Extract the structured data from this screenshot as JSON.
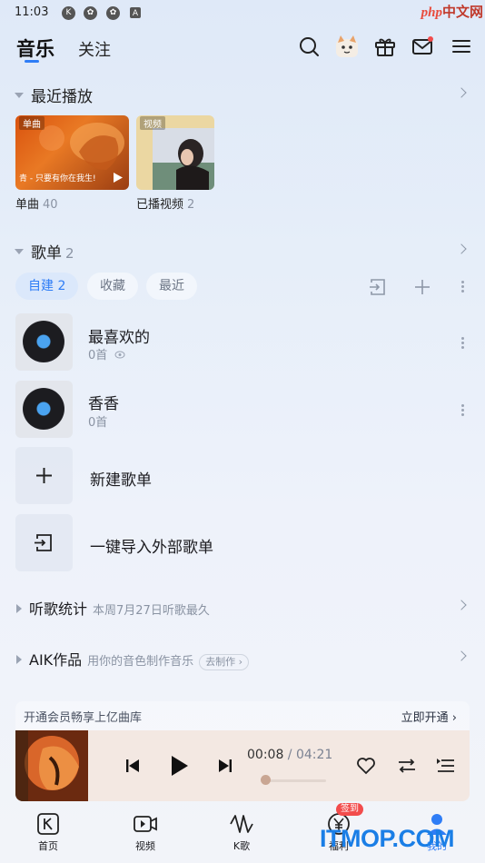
{
  "status_bar": {
    "time": "11:03",
    "icons": [
      "k-icon",
      "butterfly-icon",
      "butterfly-icon",
      "a-icon"
    ]
  },
  "watermark": {
    "php": "php",
    "cn": "中文网"
  },
  "header": {
    "tab_music": "音乐",
    "tab_follow": "关注"
  },
  "recent": {
    "title": "最近播放",
    "items": [
      {
        "tag": "单曲",
        "caption": "青 - 只要有你在我生!",
        "label": "单曲",
        "count": "40"
      },
      {
        "tag": "视频",
        "label": "已播视频",
        "count": "2"
      }
    ]
  },
  "playlists": {
    "title": "歌单",
    "count": "2",
    "chips": [
      "自建 2",
      "收藏",
      "最近"
    ],
    "items": [
      {
        "title": "最喜欢的",
        "sub": "0首"
      },
      {
        "title": "香香",
        "sub": "0首"
      }
    ],
    "actions": [
      "新建歌单",
      "一键导入外部歌单"
    ]
  },
  "stats": {
    "title": "听歌统计",
    "sub": "本周7月27日听歌最久"
  },
  "aik": {
    "title": "AIK作品",
    "sub": "用你的音色制作音乐",
    "pill": "去制作"
  },
  "vip": {
    "left": "开通会员畅享上亿曲库",
    "right": "立即开通"
  },
  "player": {
    "current": "00:08",
    "separator": " / ",
    "total": "04:21",
    "progress": 0.03
  },
  "nav": {
    "items": [
      "首页",
      "视频",
      "K歌",
      "福利",
      "我的"
    ],
    "badge": "签到"
  },
  "brand_watermark": "ITMOP.COM",
  "colors": {
    "accent": "#2f7df6",
    "badge": "#f24c4c"
  }
}
